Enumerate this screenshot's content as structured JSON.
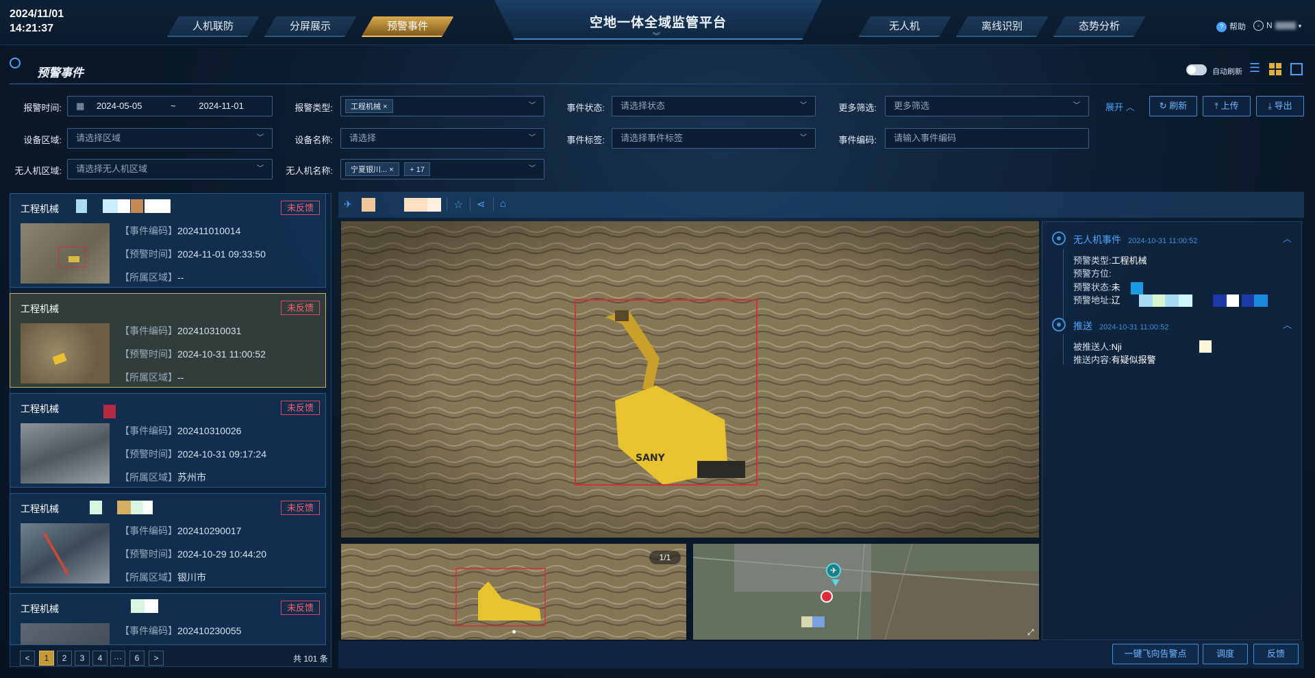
{
  "header": {
    "date": "2024/11/01",
    "time": "14:21:37",
    "app_title": "空地一体全域监管平台",
    "left_tabs": [
      "人机联防",
      "分屏展示",
      "预警事件"
    ],
    "right_tabs": [
      "无人机",
      "离线识别",
      "态势分析"
    ],
    "help_label": "帮助",
    "user_name": "N"
  },
  "section": {
    "title": "预警事件",
    "auto_refresh_label": "自动刷新"
  },
  "filters": {
    "time_label": "报警时间:",
    "date_start": "2024-05-05",
    "date_sep": "~",
    "date_end": "2024-11-01",
    "type_label": "报警类型:",
    "type_tag": "工程机械",
    "status_label": "事件状态:",
    "status_placeholder": "请选择状态",
    "more_label": "更多筛选:",
    "more_placeholder": "更多筛选",
    "expand_label": "展开",
    "refresh_label": "刷新",
    "upload_label": "上传",
    "export_label": "导出",
    "region_label": "设备区域:",
    "region_placeholder": "请选择区域",
    "device_label": "设备名称:",
    "device_placeholder": "请选择",
    "tag_label": "事件标签:",
    "tag_placeholder": "请选择事件标签",
    "code_label": "事件编码:",
    "code_placeholder": "请输入事件编码",
    "uav_region_label": "无人机区域:",
    "uav_region_placeholder": "请选择无人机区域",
    "uav_name_label": "无人机名称:",
    "uav_tag": "宁夏银川...",
    "uav_more": "+ 17"
  },
  "list": {
    "code_label": "【事件编码】",
    "time_label": "【预警时间】",
    "area_label": "【所属区域】",
    "items": [
      {
        "title": "工程机械",
        "status": "未反馈",
        "code": "202411010014",
        "time": "2024-11-01 09:33:50",
        "area": "--"
      },
      {
        "title": "工程机械",
        "status": "未反馈",
        "code": "202410310031",
        "time": "2024-10-31 11:00:52",
        "area": "--"
      },
      {
        "title": "工程机械",
        "status": "未反馈",
        "code": "202410310026",
        "time": "2024-10-31 09:17:24",
        "area": "苏州市"
      },
      {
        "title": "工程机械",
        "status": "未反馈",
        "code": "202410290017",
        "time": "2024-10-29 10:44:20",
        "area": "银川市"
      },
      {
        "title": "工程机械",
        "status": "未反馈",
        "code": "202410230055",
        "time": "",
        "area": ""
      }
    ],
    "pages": [
      "1",
      "2",
      "3",
      "4",
      "···",
      "6"
    ],
    "prev": "<",
    "next": ">",
    "total": "共 101 条"
  },
  "viewer": {
    "counter": "1/1"
  },
  "detail": {
    "event_title": "无人机事件",
    "event_time": "2024-10-31 11:00:52",
    "type_label": "预警类型:",
    "type_value": "工程机械",
    "direction_label": "预警方位:",
    "status_label": "预警状态:",
    "status_value": "未",
    "address_label": "预警地址:",
    "address_value": "辽",
    "push_title": "推送",
    "push_time": "2024-10-31 11:00:52",
    "pushee_label": "被推送人:",
    "pushee_value": "Nji",
    "content_label": "推送内容:",
    "content_value": "有疑似报警"
  },
  "actions": {
    "fly_label": "一键飞向告警点",
    "dispatch_label": "调度",
    "feedback_label": "反馈"
  },
  "colors": {
    "accent": "#3f8fd8",
    "active_tab": "#d9a84a",
    "alert": "#ff5f72",
    "detection_box": "#d0303a"
  }
}
